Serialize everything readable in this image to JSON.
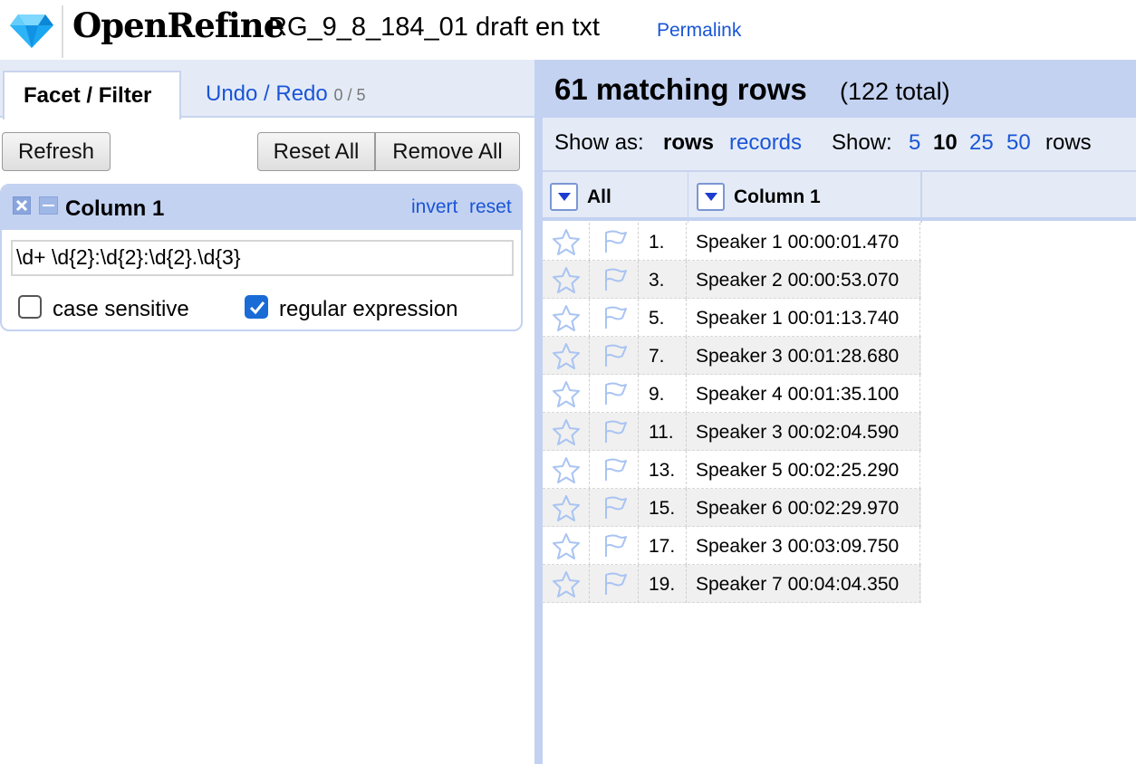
{
  "header": {
    "app_name": "OpenRefine",
    "project_name": "RG_9_8_184_01 draft en txt",
    "permalink": "Permalink",
    "logo_icon": "diamond-icon"
  },
  "left_panel": {
    "tabs": {
      "facet_filter": "Facet / Filter",
      "undo_redo": "Undo / Redo",
      "undo_count": "0 / 5"
    },
    "buttons": {
      "refresh": "Refresh",
      "reset_all": "Reset All",
      "remove_all": "Remove All"
    },
    "facet": {
      "title": "Column 1",
      "invert": "invert",
      "reset": "reset",
      "pattern": "\\d+ \\d{2}:\\d{2}:\\d{2}.\\d{3}",
      "case_sensitive_label": "case sensitive",
      "case_sensitive_checked": false,
      "regex_label": "regular expression",
      "regex_checked": true
    }
  },
  "right_panel": {
    "summary": {
      "matching": "61 matching rows",
      "total": "(122 total)"
    },
    "view": {
      "show_as_label": "Show as:",
      "rows": "rows",
      "records": "records",
      "show_label": "Show:",
      "page_sizes": [
        "5",
        "10",
        "25",
        "50"
      ],
      "selected_page_size": "10",
      "rows_suffix": "rows"
    },
    "columns": {
      "all": "All",
      "col1": "Column 1"
    },
    "rows": [
      {
        "index": "1.",
        "value": "Speaker 1 00:00:01.470"
      },
      {
        "index": "3.",
        "value": "Speaker 2 00:00:53.070"
      },
      {
        "index": "5.",
        "value": "Speaker 1 00:01:13.740"
      },
      {
        "index": "7.",
        "value": "Speaker 3 00:01:28.680"
      },
      {
        "index": "9.",
        "value": "Speaker 4 00:01:35.100"
      },
      {
        "index": "11.",
        "value": "Speaker 3 00:02:04.590"
      },
      {
        "index": "13.",
        "value": "Speaker 5 00:02:25.290"
      },
      {
        "index": "15.",
        "value": "Speaker 6 00:02:29.970"
      },
      {
        "index": "17.",
        "value": "Speaker 3 00:03:09.750"
      },
      {
        "index": "19.",
        "value": "Speaker 7 00:04:04.350"
      }
    ]
  },
  "colors": {
    "accent_blue": "#1a55d6",
    "panel_blue": "#c3d2f1",
    "light_blue": "#e4ebf7"
  }
}
